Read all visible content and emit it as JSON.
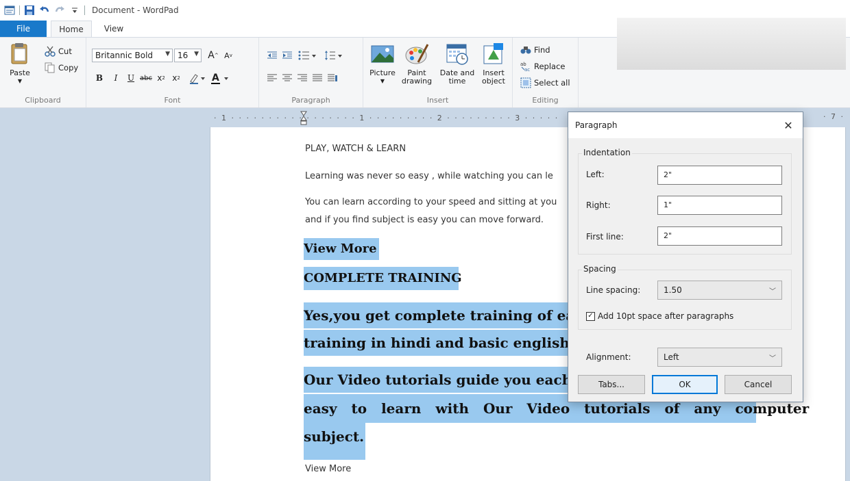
{
  "window": {
    "title": "Document - WordPad"
  },
  "tabs": {
    "file": "File",
    "home": "Home",
    "view": "View"
  },
  "ribbon": {
    "clipboard": {
      "label": "Clipboard",
      "paste": "Paste",
      "cut": "Cut",
      "copy": "Copy"
    },
    "font": {
      "label": "Font",
      "family": "Britannic Bold",
      "size": "16"
    },
    "paragraph": {
      "label": "Paragraph"
    },
    "insert": {
      "label": "Insert",
      "picture": "Picture",
      "paint_drawing_1": "Paint",
      "paint_drawing_2": "drawing",
      "date_time_1": "Date and",
      "date_time_2": "time",
      "insert_object_1": "Insert",
      "insert_object_2": "object"
    },
    "editing": {
      "label": "Editing",
      "find": "Find",
      "replace": "Replace",
      "select_all": "Select all"
    }
  },
  "ruler": {
    "marks": "· 1 · · · · · · · · · · · · · · · · · 1 · · · · · · · · · 2 · · · · · · · · · 3 · · · · ·",
    "right_mark": "· 7 ·"
  },
  "document": {
    "line1": "PLAY, WATCH & LEARN",
    "line2": "Learning was never so easy , while watching you can le",
    "line3a": "You can learn according to your speed and sitting at you",
    "line3b": "and if you find subject is easy you can move forward.",
    "h1": "View More",
    "h2": "COMPLETE TRAINING",
    "h3": "Yes,you get complete training of eac",
    "h4": "training in hindi and basic english la",
    "h5": "Our Video tutorials guide you each a",
    "h6": "easy to learn with Our Video tutorials of any computer",
    "h7": "subject.",
    "last": "View More"
  },
  "dialog": {
    "title": "Paragraph",
    "indentation": {
      "legend": "Indentation",
      "left_label": "Left:",
      "left_value": "2\"",
      "right_label": "Right:",
      "right_value": "1\"",
      "first_label": "First line:",
      "first_value": "2\""
    },
    "spacing": {
      "legend": "Spacing",
      "line_label": "Line spacing:",
      "line_value": "1.50",
      "add_space": "Add 10pt space after paragraphs",
      "add_space_checked": true
    },
    "alignment_label": "Alignment:",
    "alignment_value": "Left",
    "buttons": {
      "tabs": "Tabs...",
      "ok": "OK",
      "cancel": "Cancel"
    }
  },
  "colors": {
    "accent": "#1979ca",
    "highlight": "#99c9ef",
    "workspace": "#c9d7e6"
  }
}
